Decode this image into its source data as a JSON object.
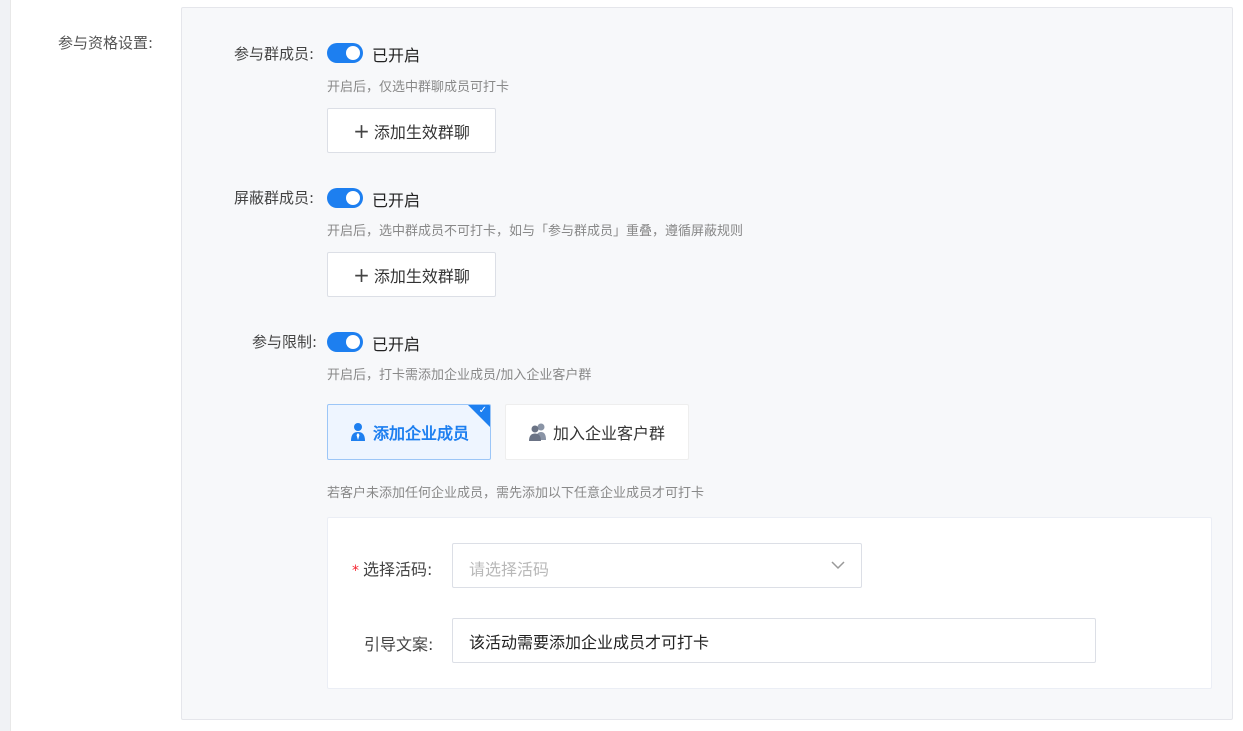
{
  "section": {
    "label": "参与资格设置:"
  },
  "participate_group": {
    "label": "参与群成员:",
    "toggle_state": "已开启",
    "hint": "开启后，仅选中群聊成员可打卡",
    "add_button": {
      "plus": "+",
      "label": "添加生效群聊"
    }
  },
  "block_group": {
    "label": "屏蔽群成员:",
    "toggle_state": "已开启",
    "hint": "开启后，选中群成员不可打卡，如与「参与群成员」重叠，遵循屏蔽规则",
    "add_button": {
      "plus": "+",
      "label": "添加生效群聊"
    }
  },
  "participate_limit": {
    "label": "参与限制:",
    "toggle_state": "已开启",
    "hint": "开启后，打卡需添加企业成员/加入企业客户群",
    "options": [
      {
        "label": "添加企业成员",
        "icon": "person-icon",
        "selected": true
      },
      {
        "label": "加入企业客户群",
        "icon": "group-icon",
        "selected": false
      }
    ],
    "selected_check": "✓",
    "option_hint": "若客户未添加任何企业成员，需先添加以下任意企业成员才可打卡"
  },
  "form": {
    "required_mark": "*",
    "select_label": "选择活码:",
    "select_placeholder": "请选择活码",
    "guide_label": "引导文案:",
    "guide_value": "该活动需要添加企业成员才可打卡"
  },
  "colors": {
    "accent": "#1d7ff0",
    "panel_bg": "#f7f8fa",
    "hint": "#888888"
  }
}
